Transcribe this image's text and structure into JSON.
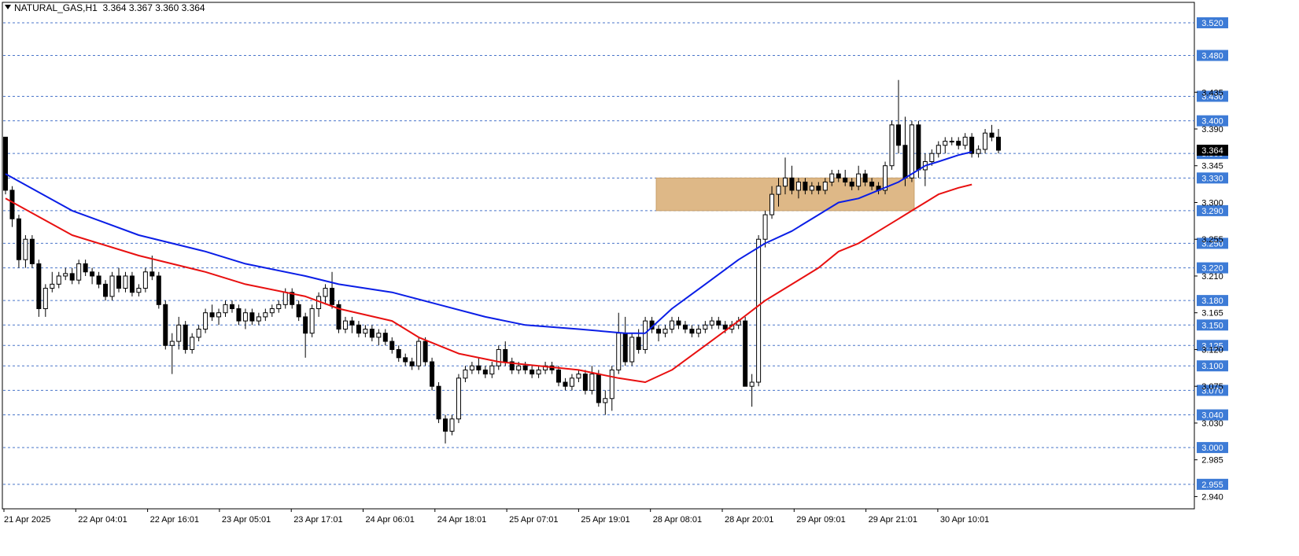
{
  "header": {
    "symbol": "NATURAL_GAS,H1",
    "ohlc": "3.364 3.367 3.360 3.364"
  },
  "colors": {
    "background": "#ffffff",
    "grid_level": "#4a76c9",
    "level_label_bg": "#3d7bd6",
    "ma_fast": "#0a1ee6",
    "ma_slow": "#e81010",
    "zone": "#deb887",
    "candle": "#000000"
  },
  "chart_data": {
    "type": "candlestick",
    "ylim": [
      2.925,
      3.545
    ],
    "price_ticks": [
      "2.940",
      "2.985",
      "3.030",
      "3.075",
      "3.120",
      "3.165",
      "3.210",
      "3.255",
      "3.300",
      "3.345",
      "3.390",
      "3.435"
    ],
    "levels": [
      "2.955",
      "3.000",
      "3.040",
      "3.070",
      "3.100",
      "3.125",
      "3.150",
      "3.180",
      "3.220",
      "3.250",
      "3.290",
      "3.330",
      "3.360",
      "3.400",
      "3.430",
      "3.480",
      "3.520"
    ],
    "current_price": "3.364",
    "time_labels": [
      "21 Apr 2025",
      "22 Apr 04:01",
      "22 Apr 16:01",
      "23 Apr 05:01",
      "23 Apr 17:01",
      "24 Apr 06:01",
      "24 Apr 18:01",
      "25 Apr 07:01",
      "25 Apr 19:01",
      "28 Apr 08:01",
      "28 Apr 20:01",
      "29 Apr 09:01",
      "29 Apr 21:01",
      "30 Apr 10:01"
    ],
    "zone": {
      "from_bar": 98,
      "to_bar": 136,
      "low": 3.29,
      "high": 3.33
    },
    "ma_fast": [
      [
        0,
        3.335
      ],
      [
        10,
        3.29
      ],
      [
        20,
        3.26
      ],
      [
        30,
        3.24
      ],
      [
        36,
        3.225
      ],
      [
        45,
        3.21
      ],
      [
        50,
        3.2
      ],
      [
        58,
        3.19
      ],
      [
        65,
        3.175
      ],
      [
        72,
        3.16
      ],
      [
        78,
        3.15
      ],
      [
        86,
        3.145
      ],
      [
        93,
        3.14
      ],
      [
        96,
        3.14
      ],
      [
        100,
        3.17
      ],
      [
        105,
        3.2
      ],
      [
        110,
        3.23
      ],
      [
        114,
        3.25
      ],
      [
        118,
        3.265
      ],
      [
        122,
        3.285
      ],
      [
        125,
        3.3
      ],
      [
        128,
        3.305
      ],
      [
        131,
        3.315
      ],
      [
        134,
        3.325
      ],
      [
        136,
        3.335
      ],
      [
        138,
        3.345
      ],
      [
        140,
        3.35
      ],
      [
        143,
        3.358
      ],
      [
        145,
        3.362
      ]
    ],
    "ma_slow": [
      [
        0,
        3.305
      ],
      [
        10,
        3.26
      ],
      [
        20,
        3.235
      ],
      [
        30,
        3.215
      ],
      [
        36,
        3.2
      ],
      [
        45,
        3.185
      ],
      [
        50,
        3.17
      ],
      [
        58,
        3.155
      ],
      [
        62,
        3.135
      ],
      [
        68,
        3.115
      ],
      [
        74,
        3.105
      ],
      [
        80,
        3.1
      ],
      [
        86,
        3.095
      ],
      [
        92,
        3.085
      ],
      [
        96,
        3.08
      ],
      [
        100,
        3.095
      ],
      [
        105,
        3.125
      ],
      [
        110,
        3.155
      ],
      [
        114,
        3.18
      ],
      [
        118,
        3.2
      ],
      [
        122,
        3.22
      ],
      [
        125,
        3.24
      ],
      [
        128,
        3.25
      ],
      [
        131,
        3.265
      ],
      [
        134,
        3.28
      ],
      [
        136,
        3.29
      ],
      [
        138,
        3.3
      ],
      [
        140,
        3.31
      ],
      [
        143,
        3.318
      ],
      [
        145,
        3.322
      ]
    ],
    "candles": [
      [
        3.38,
        3.38,
        3.31,
        3.315
      ],
      [
        3.315,
        3.32,
        3.27,
        3.28
      ],
      [
        3.28,
        3.285,
        3.22,
        3.23
      ],
      [
        3.23,
        3.26,
        3.22,
        3.255
      ],
      [
        3.255,
        3.26,
        3.22,
        3.225
      ],
      [
        3.225,
        3.23,
        3.16,
        3.17
      ],
      [
        3.17,
        3.2,
        3.16,
        3.195
      ],
      [
        3.195,
        3.215,
        3.19,
        3.2
      ],
      [
        3.2,
        3.215,
        3.195,
        3.21
      ],
      [
        3.21,
        3.22,
        3.205,
        3.213
      ],
      [
        3.213,
        3.22,
        3.2,
        3.205
      ],
      [
        3.205,
        3.23,
        3.2,
        3.225
      ],
      [
        3.225,
        3.23,
        3.21,
        3.215
      ],
      [
        3.215,
        3.22,
        3.2,
        3.21
      ],
      [
        3.21,
        3.215,
        3.195,
        3.2
      ],
      [
        3.2,
        3.205,
        3.18,
        3.185
      ],
      [
        3.185,
        3.215,
        3.18,
        3.21
      ],
      [
        3.21,
        3.22,
        3.19,
        3.195
      ],
      [
        3.195,
        3.215,
        3.19,
        3.21
      ],
      [
        3.21,
        3.215,
        3.185,
        3.19
      ],
      [
        3.19,
        3.2,
        3.185,
        3.195
      ],
      [
        3.195,
        3.22,
        3.19,
        3.215
      ],
      [
        3.215,
        3.235,
        3.205,
        3.21
      ],
      [
        3.21,
        3.215,
        3.17,
        3.175
      ],
      [
        3.175,
        3.18,
        3.12,
        3.125
      ],
      [
        3.125,
        3.14,
        3.09,
        3.13
      ],
      [
        3.13,
        3.16,
        3.12,
        3.15
      ],
      [
        3.15,
        3.155,
        3.115,
        3.12
      ],
      [
        3.12,
        3.14,
        3.115,
        3.135
      ],
      [
        3.135,
        3.15,
        3.13,
        3.145
      ],
      [
        3.145,
        3.17,
        3.14,
        3.165
      ],
      [
        3.165,
        3.175,
        3.155,
        3.16
      ],
      [
        3.16,
        3.17,
        3.15,
        3.165
      ],
      [
        3.165,
        3.18,
        3.16,
        3.175
      ],
      [
        3.175,
        3.18,
        3.165,
        3.17
      ],
      [
        3.17,
        3.175,
        3.15,
        3.155
      ],
      [
        3.155,
        3.17,
        3.145,
        3.165
      ],
      [
        3.165,
        3.17,
        3.15,
        3.155
      ],
      [
        3.155,
        3.165,
        3.15,
        3.16
      ],
      [
        3.16,
        3.17,
        3.155,
        3.165
      ],
      [
        3.165,
        3.175,
        3.16,
        3.17
      ],
      [
        3.17,
        3.18,
        3.165,
        3.175
      ],
      [
        3.175,
        3.195,
        3.17,
        3.19
      ],
      [
        3.19,
        3.195,
        3.17,
        3.175
      ],
      [
        3.175,
        3.18,
        3.155,
        3.16
      ],
      [
        3.16,
        3.165,
        3.11,
        3.14
      ],
      [
        3.14,
        3.175,
        3.135,
        3.17
      ],
      [
        3.17,
        3.19,
        3.16,
        3.185
      ],
      [
        3.185,
        3.2,
        3.175,
        3.195
      ],
      [
        3.195,
        3.215,
        3.17,
        3.175
      ],
      [
        3.175,
        3.18,
        3.14,
        3.145
      ],
      [
        3.145,
        3.16,
        3.14,
        3.155
      ],
      [
        3.155,
        3.16,
        3.14,
        3.15
      ],
      [
        3.15,
        3.155,
        3.135,
        3.14
      ],
      [
        3.14,
        3.15,
        3.135,
        3.145
      ],
      [
        3.145,
        3.15,
        3.13,
        3.135
      ],
      [
        3.135,
        3.145,
        3.125,
        3.14
      ],
      [
        3.14,
        3.145,
        3.125,
        3.13
      ],
      [
        3.13,
        3.135,
        3.115,
        3.12
      ],
      [
        3.12,
        3.125,
        3.105,
        3.11
      ],
      [
        3.11,
        3.115,
        3.1,
        3.105
      ],
      [
        3.105,
        3.11,
        3.095,
        3.1
      ],
      [
        3.1,
        3.135,
        3.095,
        3.13
      ],
      [
        3.13,
        3.135,
        3.1,
        3.105
      ],
      [
        3.105,
        3.11,
        3.07,
        3.075
      ],
      [
        3.075,
        3.08,
        3.03,
        3.035
      ],
      [
        3.035,
        3.04,
        3.005,
        3.02
      ],
      [
        3.02,
        3.04,
        3.015,
        3.035
      ],
      [
        3.035,
        3.09,
        3.03,
        3.085
      ],
      [
        3.085,
        3.1,
        3.08,
        3.095
      ],
      [
        3.095,
        3.105,
        3.09,
        3.1
      ],
      [
        3.1,
        3.11,
        3.09,
        3.095
      ],
      [
        3.095,
        3.1,
        3.085,
        3.09
      ],
      [
        3.09,
        3.105,
        3.085,
        3.1
      ],
      [
        3.1,
        3.125,
        3.095,
        3.12
      ],
      [
        3.12,
        3.13,
        3.1,
        3.105
      ],
      [
        3.105,
        3.11,
        3.09,
        3.095
      ],
      [
        3.095,
        3.105,
        3.09,
        3.1
      ],
      [
        3.1,
        3.105,
        3.09,
        3.095
      ],
      [
        3.095,
        3.1,
        3.085,
        3.09
      ],
      [
        3.09,
        3.1,
        3.085,
        3.095
      ],
      [
        3.095,
        3.105,
        3.09,
        3.1
      ],
      [
        3.1,
        3.105,
        3.09,
        3.095
      ],
      [
        3.095,
        3.1,
        3.075,
        3.08
      ],
      [
        3.08,
        3.085,
        3.07,
        3.075
      ],
      [
        3.075,
        3.09,
        3.07,
        3.085
      ],
      [
        3.085,
        3.095,
        3.08,
        3.09
      ],
      [
        3.09,
        3.095,
        3.065,
        3.07
      ],
      [
        3.07,
        3.1,
        3.065,
        3.09
      ],
      [
        3.09,
        3.095,
        3.05,
        3.055
      ],
      [
        3.055,
        3.07,
        3.04,
        3.06
      ],
      [
        3.06,
        3.1,
        3.045,
        3.095
      ],
      [
        3.095,
        3.165,
        3.09,
        3.14
      ],
      [
        3.14,
        3.16,
        3.1,
        3.105
      ],
      [
        3.105,
        3.14,
        3.1,
        3.135
      ],
      [
        3.135,
        3.145,
        3.115,
        3.12
      ],
      [
        3.12,
        3.16,
        3.115,
        3.155
      ],
      [
        3.155,
        3.16,
        3.14,
        3.145
      ],
      [
        3.145,
        3.15,
        3.13,
        3.14
      ],
      [
        3.14,
        3.15,
        3.135,
        3.145
      ],
      [
        3.145,
        3.16,
        3.14,
        3.155
      ],
      [
        3.155,
        3.16,
        3.145,
        3.15
      ],
      [
        3.15,
        3.155,
        3.14,
        3.145
      ],
      [
        3.145,
        3.15,
        3.135,
        3.14
      ],
      [
        3.14,
        3.15,
        3.135,
        3.145
      ],
      [
        3.145,
        3.155,
        3.14,
        3.15
      ],
      [
        3.15,
        3.16,
        3.145,
        3.155
      ],
      [
        3.155,
        3.16,
        3.145,
        3.15
      ],
      [
        3.15,
        3.155,
        3.14,
        3.145
      ],
      [
        3.145,
        3.155,
        3.14,
        3.15
      ],
      [
        3.15,
        3.16,
        3.145,
        3.155
      ],
      [
        3.155,
        3.16,
        3.12,
        3.075
      ],
      [
        3.075,
        3.09,
        3.05,
        3.08
      ],
      [
        3.08,
        3.26,
        3.075,
        3.255
      ],
      [
        3.255,
        3.29,
        3.245,
        3.285
      ],
      [
        3.285,
        3.32,
        3.28,
        3.31
      ],
      [
        3.31,
        3.33,
        3.295,
        3.32
      ],
      [
        3.32,
        3.355,
        3.31,
        3.33
      ],
      [
        3.33,
        3.345,
        3.31,
        3.315
      ],
      [
        3.315,
        3.33,
        3.305,
        3.325
      ],
      [
        3.325,
        3.33,
        3.31,
        3.315
      ],
      [
        3.315,
        3.325,
        3.31,
        3.32
      ],
      [
        3.32,
        3.325,
        3.31,
        3.315
      ],
      [
        3.315,
        3.33,
        3.31,
        3.325
      ],
      [
        3.325,
        3.34,
        3.32,
        3.335
      ],
      [
        3.335,
        3.34,
        3.325,
        3.33
      ],
      [
        3.33,
        3.34,
        3.32,
        3.325
      ],
      [
        3.325,
        3.33,
        3.315,
        3.32
      ],
      [
        3.32,
        3.345,
        3.315,
        3.335
      ],
      [
        3.335,
        3.34,
        3.32,
        3.325
      ],
      [
        3.325,
        3.33,
        3.315,
        3.32
      ],
      [
        3.32,
        3.325,
        3.31,
        3.315
      ],
      [
        3.315,
        3.35,
        3.31,
        3.345
      ],
      [
        3.345,
        3.4,
        3.34,
        3.395
      ],
      [
        3.395,
        3.45,
        3.36,
        3.37
      ],
      [
        3.37,
        3.405,
        3.32,
        3.33
      ],
      [
        3.33,
        3.4,
        3.325,
        3.395
      ],
      [
        3.395,
        3.4,
        3.33,
        3.34
      ],
      [
        3.34,
        3.36,
        3.32,
        3.35
      ],
      [
        3.35,
        3.365,
        3.345,
        3.36
      ],
      [
        3.36,
        3.375,
        3.355,
        3.37
      ],
      [
        3.37,
        3.38,
        3.36,
        3.375
      ],
      [
        3.375,
        3.38,
        3.37,
        3.375
      ],
      [
        3.375,
        3.38,
        3.365,
        3.37
      ],
      [
        3.37,
        3.385,
        3.365,
        3.38
      ],
      [
        3.38,
        3.385,
        3.355,
        3.36
      ],
      [
        3.36,
        3.37,
        3.355,
        3.365
      ],
      [
        3.365,
        3.39,
        3.36,
        3.385
      ],
      [
        3.385,
        3.395,
        3.375,
        3.38
      ],
      [
        3.38,
        3.39,
        3.36,
        3.364
      ]
    ]
  }
}
